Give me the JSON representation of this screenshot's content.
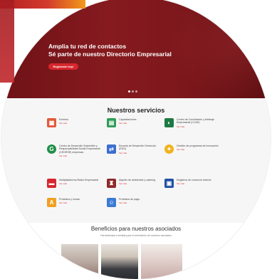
{
  "hero": {
    "line1": "Amplia tu red de contactos",
    "line2": "Sé parte de nuestro Directorio Empresarial",
    "button": "Regístrate hoy!"
  },
  "services": {
    "title": "Nuestros servicios",
    "more_label": "Ver más",
    "items": [
      {
        "name": "Eventos",
        "icon": "calendar-icon",
        "color": "#e25b3b"
      },
      {
        "name": "Capacitaciones",
        "icon": "training-icon",
        "color": "#2f9d57"
      },
      {
        "name": "Centro de Conciliación y Arbitraje Empresarial (CCAE)",
        "icon": "scales-icon",
        "color": "#1d7a43"
      },
      {
        "name": "Centro de Desarrollo Sostenible y Responsabilidad Social Empresarial (CEDRSE) empresas",
        "icon": "leaf-icon",
        "color": "#1f8f4a"
      },
      {
        "name": "Escuela de Desarrollo Gerencial (EDG)",
        "icon": "network-icon",
        "color": "#3c6ed1"
      },
      {
        "name": "Gestión de programas de innovación",
        "icon": "bulb-icon",
        "color": "#f2b21c"
      },
      {
        "name": "Multiplataforma Radio Empresarial",
        "icon": "radio-icon",
        "color": "#d7262d"
      },
      {
        "name": "Alquiler de ambientes y catering",
        "icon": "room-icon",
        "color": "#8e2b2b"
      },
      {
        "name": "Registros de comercio exterior",
        "icon": "trade-icon",
        "color": "#2350a3"
      },
      {
        "name": "Protestos y moras",
        "icon": "scale-icon",
        "color": "#f0a021"
      },
      {
        "name": "Protestos de pago",
        "icon": "payment-icon",
        "color": "#3a7bd5"
      }
    ]
  },
  "benefits": {
    "title": "Beneficios para nuestros asociados",
    "subtitle": "Herramientas a medida para el crecimiento de nuestros asociados"
  }
}
